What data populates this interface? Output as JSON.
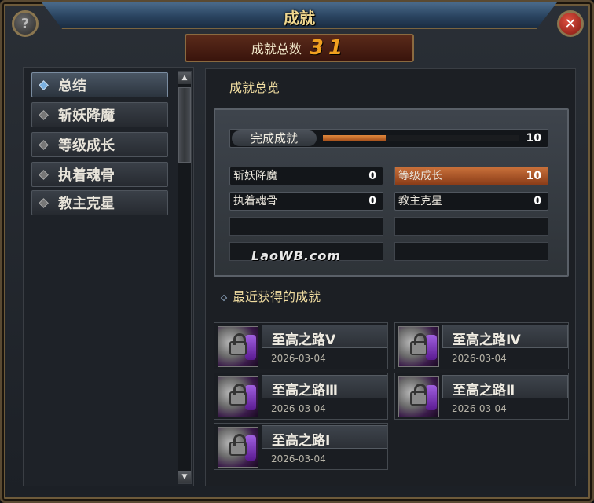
{
  "window": {
    "title": "成就"
  },
  "header": {
    "total_label": "成就总数",
    "total_value": "31"
  },
  "nav": {
    "items": [
      {
        "label": "总结",
        "active": true
      },
      {
        "label": "斩妖降魔",
        "active": false
      },
      {
        "label": "等级成长",
        "active": false
      },
      {
        "label": "执着魂骨",
        "active": false
      },
      {
        "label": "教主克星",
        "active": false
      }
    ]
  },
  "overview": {
    "title": "成就总览",
    "main": {
      "label": "完成成就",
      "value": "10",
      "progress": 0.32
    },
    "categories": [
      {
        "label": "斩妖降魔",
        "value": "0",
        "progress": 0
      },
      {
        "label": "等级成长",
        "value": "10",
        "progress": 1
      },
      {
        "label": "执着魂骨",
        "value": "0",
        "progress": 0
      },
      {
        "label": "教主克星",
        "value": "0",
        "progress": 0
      }
    ],
    "watermark": "LaoWB.com"
  },
  "recent": {
    "title": "最近获得的成就",
    "items": [
      {
        "name": "至高之路Ⅴ",
        "date": "2026-03-04"
      },
      {
        "name": "至高之路Ⅳ",
        "date": "2026-03-04"
      },
      {
        "name": "至高之路Ⅲ",
        "date": "2026-03-04"
      },
      {
        "name": "至高之路Ⅱ",
        "date": "2026-03-04"
      },
      {
        "name": "至高之路Ⅰ",
        "date": "2026-03-04"
      }
    ]
  },
  "icons": {
    "help": "?",
    "close": "✕",
    "scroll_up": "▲",
    "scroll_down": "▼"
  }
}
